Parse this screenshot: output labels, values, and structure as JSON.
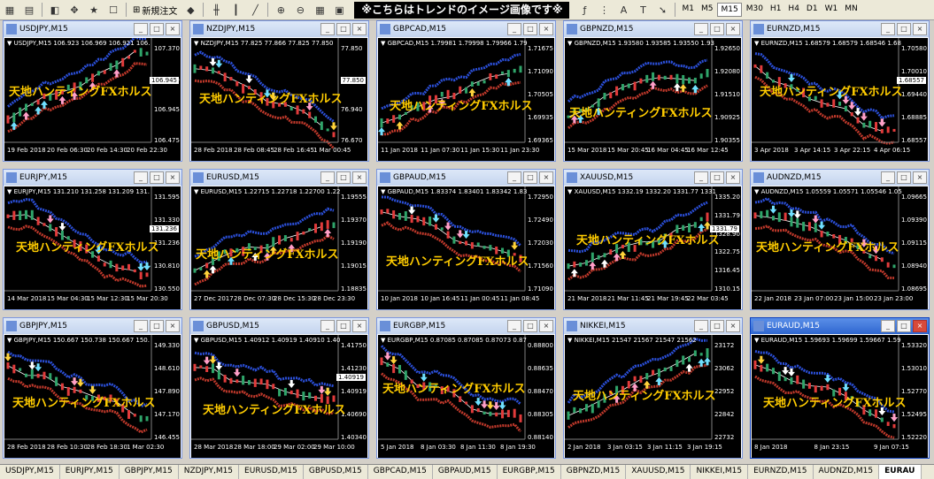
{
  "toolbar": {
    "new_order_label": "新規注文",
    "banner": "※こちらはトレンドのイメージ画像です※",
    "timeframes": [
      "M1",
      "M5",
      "M15",
      "M30",
      "H1",
      "H4",
      "D1",
      "W1",
      "MN"
    ],
    "active_timeframe": "M15"
  },
  "overlay_text": "天地ハンティングFXホルス",
  "colors": {
    "band_red": "#c0392b",
    "band_blue": "#2b4fd8",
    "candle_up": "#2fa56a",
    "candle_down": "#e23b3b",
    "arrow_pink": "#ff9ec7",
    "arrow_cyan": "#6fe0ff",
    "arrow_yellow": "#ffd23a",
    "overlay": "#ffcc00"
  },
  "charts": [
    {
      "title": "USDJPY,M15",
      "quote": "USDJPY,M15 106.923 106.969 106.921 106.",
      "y_labels": [
        "107.370",
        "107.145",
        "106.945",
        "106.475"
      ],
      "price_tag": "106.945",
      "dates": [
        "19 Feb 2018",
        "20 Feb 06:30",
        "20 Feb 14:30",
        "20 Feb 22:30"
      ],
      "trend": "up"
    },
    {
      "title": "NZDJPY,M15",
      "quote": "NZDJPY,M15 77.825 77.866 77.825 77.850",
      "y_labels": [
        "77.850",
        "77.210",
        "76.940",
        "76.670"
      ],
      "price_tag": "77.850",
      "dates": [
        "28 Feb 2018",
        "28 Feb 08:45",
        "28 Feb 16:45",
        "1 Mar 00:45"
      ],
      "trend": "down"
    },
    {
      "title": "GBPCAD,M15",
      "quote": "GBPCAD,M15 1.79981 1.79998 1.79966 1.79",
      "y_labels": [
        "1.71675",
        "1.71090",
        "1.70505",
        "1.69935",
        "1.69365"
      ],
      "price_tag": "",
      "dates": [
        "11 Jan 2018",
        "11 Jan 07:30",
        "11 Jan 15:30",
        "11 Jan 23:30"
      ],
      "trend": "up"
    },
    {
      "title": "GBPNZD,M15",
      "quote": "GBPNZD,M15 1.93580 1.93585 1.93550 1.93",
      "y_labels": [
        "1.92650",
        "1.92080",
        "1.91510",
        "1.90925",
        "1.90355"
      ],
      "price_tag": "",
      "dates": [
        "15 Mar 2018",
        "15 Mar 20:45",
        "16 Mar 04:45",
        "16 Mar 12:45"
      ],
      "trend": "up"
    },
    {
      "title": "EURNZD,M15",
      "quote": "EURNZD,M15 1.68579 1.68579 1.68546 1.68",
      "y_labels": [
        "1.70580",
        "1.70010",
        "1.69440",
        "1.68885",
        "1.68557"
      ],
      "price_tag": "1.68557",
      "dates": [
        "3 Apr 2018",
        "3 Apr 14:15",
        "3 Apr 22:15",
        "4 Apr 06:15"
      ],
      "trend": "down"
    },
    {
      "title": "EURJPY,M15",
      "quote": "EURJPY,M15 131.210 131.258 131.209 131.",
      "y_labels": [
        "131.595",
        "131.330",
        "131.236",
        "130.810",
        "130.550"
      ],
      "price_tag": "131.236",
      "dates": [
        "14 Mar 2018",
        "15 Mar 04:30",
        "15 Mar 12:30",
        "15 Mar 20:30"
      ],
      "trend": "down"
    },
    {
      "title": "EURUSD,M15",
      "quote": "EURUSD,M15 1.22715 1.22718 1.22700 1.22",
      "y_labels": [
        "1.19555",
        "1.19370",
        "1.19190",
        "1.19015",
        "1.18835"
      ],
      "price_tag": "",
      "dates": [
        "27 Dec 2017",
        "28 Dec 07:30",
        "28 Dec 15:30",
        "28 Dec 23:30"
      ],
      "trend": "up"
    },
    {
      "title": "GBPAUD,M15",
      "quote": "GBPAUD,M15 1.83374 1.83401 1.83342 1.83",
      "y_labels": [
        "1.72950",
        "1.72490",
        "1.72030",
        "1.71560",
        "1.71090"
      ],
      "price_tag": "",
      "dates": [
        "10 Jan 2018",
        "10 Jan 16:45",
        "11 Jan 00:45",
        "11 Jan 08:45"
      ],
      "trend": "down"
    },
    {
      "title": "XAUUSD,M15",
      "quote": "XAUUSD,M15 1332.19 1332.20 1331.77 1331",
      "y_labels": [
        "1335.20",
        "1331.79",
        "1328.90",
        "1322.75",
        "1316.45",
        "1310.15"
      ],
      "price_tag": "1331.79",
      "dates": [
        "21 Mar 2018",
        "21 Mar 11:45",
        "21 Mar 19:45",
        "22 Mar 03:45"
      ],
      "trend": "up"
    },
    {
      "title": "AUDNZD,M15",
      "quote": "AUDNZD,M15 1.05559 1.05571 1.05546 1.05",
      "y_labels": [
        "1.09665",
        "1.09390",
        "1.09115",
        "1.08940",
        "1.08695"
      ],
      "price_tag": "",
      "dates": [
        "22 Jan 2018",
        "23 Jan 07:00",
        "23 Jan 15:00",
        "23 Jan 23:00"
      ],
      "trend": "down"
    },
    {
      "title": "GBPJPY,M15",
      "quote": "GBPJPY,M15 150.667 150.738 150.667 150.",
      "y_labels": [
        "149.330",
        "148.610",
        "147.890",
        "147.170",
        "146.455"
      ],
      "price_tag": "",
      "dates": [
        "28 Feb 2018",
        "28 Feb 10:30",
        "28 Feb 18:30",
        "1 Mar 02:30"
      ],
      "trend": "down"
    },
    {
      "title": "GBPUSD,M15",
      "quote": "GBPUSD,M15 1.40912 1.40919 1.40910 1.40",
      "y_labels": [
        "1.41750",
        "1.41230",
        "1.40919",
        "1.40690",
        "1.40340"
      ],
      "price_tag": "1.40919",
      "dates": [
        "28 Mar 2018",
        "28 Mar 18:00",
        "29 Mar 02:00",
        "29 Mar 10:00"
      ],
      "trend": "down"
    },
    {
      "title": "EURGBP,M15",
      "quote": "EURGBP,M15 0.87085 0.87085 0.87073 0.87",
      "y_labels": [
        "0.88800",
        "0.88635",
        "0.88470",
        "0.88305",
        "0.88140"
      ],
      "price_tag": "",
      "dates": [
        "5 Jan 2018",
        "8 Jan 03:30",
        "8 Jan 11:30",
        "8 Jan 19:30"
      ],
      "trend": "down"
    },
    {
      "title": "NIKKEI,M15",
      "quote": "NIKKEI,M15 21547 21567 21547 21562",
      "y_labels": [
        "23172",
        "23062",
        "22952",
        "22842",
        "22732"
      ],
      "price_tag": "",
      "dates": [
        "2 Jan 2018",
        "3 Jan 03:15",
        "3 Jan 11:15",
        "3 Jan 19:15"
      ],
      "trend": "up"
    },
    {
      "title": "EURAUD,M15",
      "quote": "EURAUD,M15 1.59693 1.59699 1.59667 1.59",
      "y_labels": [
        "1.53320",
        "1.53010",
        "1.52770",
        "1.52495",
        "1.52220"
      ],
      "price_tag": "",
      "dates": [
        "8 Jan 2018",
        "8 Jan 23:15",
        "9 Jan 07:15"
      ],
      "trend": "down",
      "active": true
    }
  ],
  "tabs": [
    "USDJPY,M15",
    "EURJPY,M15",
    "GBPJPY,M15",
    "NZDJPY,M15",
    "EURUSD,M15",
    "GBPUSD,M15",
    "GBPCAD,M15",
    "GBPAUD,M15",
    "EURGBP,M15",
    "GBPNZD,M15",
    "XAUUSD,M15",
    "NIKKEI,M15",
    "EURNZD,M15",
    "AUDNZD,M15",
    "EURAU"
  ],
  "active_tab": "EURAU"
}
